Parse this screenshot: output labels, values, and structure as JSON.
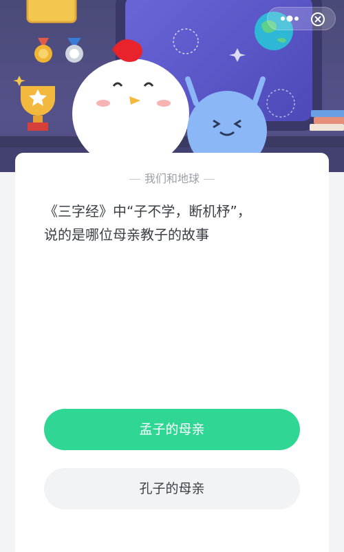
{
  "app": {
    "accent": "#2fd694"
  },
  "quiz": {
    "category": "我们和地球",
    "question_line1": "《三字经》中“子不学，断机杼”，",
    "question_line2": "说的是哪位母亲教子的故事",
    "options": [
      {
        "label": "孟子的母亲",
        "state": "selected"
      },
      {
        "label": "孔子的母亲",
        "state": "default"
      }
    ]
  },
  "header": {
    "more_icon": "more-icon",
    "close_icon": "close-icon"
  }
}
